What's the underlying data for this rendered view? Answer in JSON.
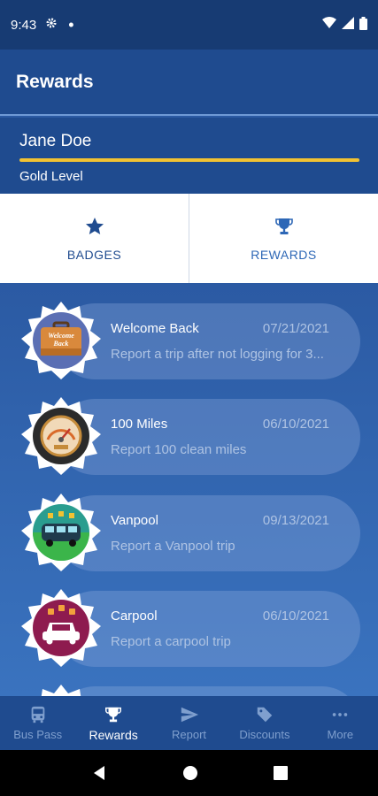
{
  "status_bar": {
    "time": "9:43"
  },
  "app_bar": {
    "title": "Rewards"
  },
  "profile": {
    "name": "Jane Doe",
    "level": "Gold Level",
    "level_color": "#f2c232"
  },
  "tabs": [
    {
      "label": "BADGES",
      "icon": "star-icon",
      "active": true
    },
    {
      "label": "REWARDS",
      "icon": "trophy-icon",
      "active": false
    }
  ],
  "badges": [
    {
      "title": "Welcome Back",
      "date": "07/21/2021",
      "description": "Report a trip after not logging for 3...",
      "icon": "suitcase-icon",
      "icon_text": "Welcome Back"
    },
    {
      "title": "100 Miles",
      "date": "06/10/2021",
      "description": "Report 100 clean miles",
      "icon": "speedometer-icon"
    },
    {
      "title": "Vanpool",
      "date": "09/13/2021",
      "description": "Report a Vanpool trip",
      "icon": "van-icon"
    },
    {
      "title": "Carpool",
      "date": "06/10/2021",
      "description": "Report a carpool trip",
      "icon": "car-icon"
    }
  ],
  "bottom_nav": [
    {
      "label": "Bus Pass",
      "icon": "bus-icon",
      "active": false
    },
    {
      "label": "Rewards",
      "icon": "trophy-icon",
      "active": true
    },
    {
      "label": "Report",
      "icon": "send-icon",
      "active": false
    },
    {
      "label": "Discounts",
      "icon": "tag-icon",
      "active": false
    },
    {
      "label": "More",
      "icon": "more-icon",
      "active": false
    }
  ]
}
